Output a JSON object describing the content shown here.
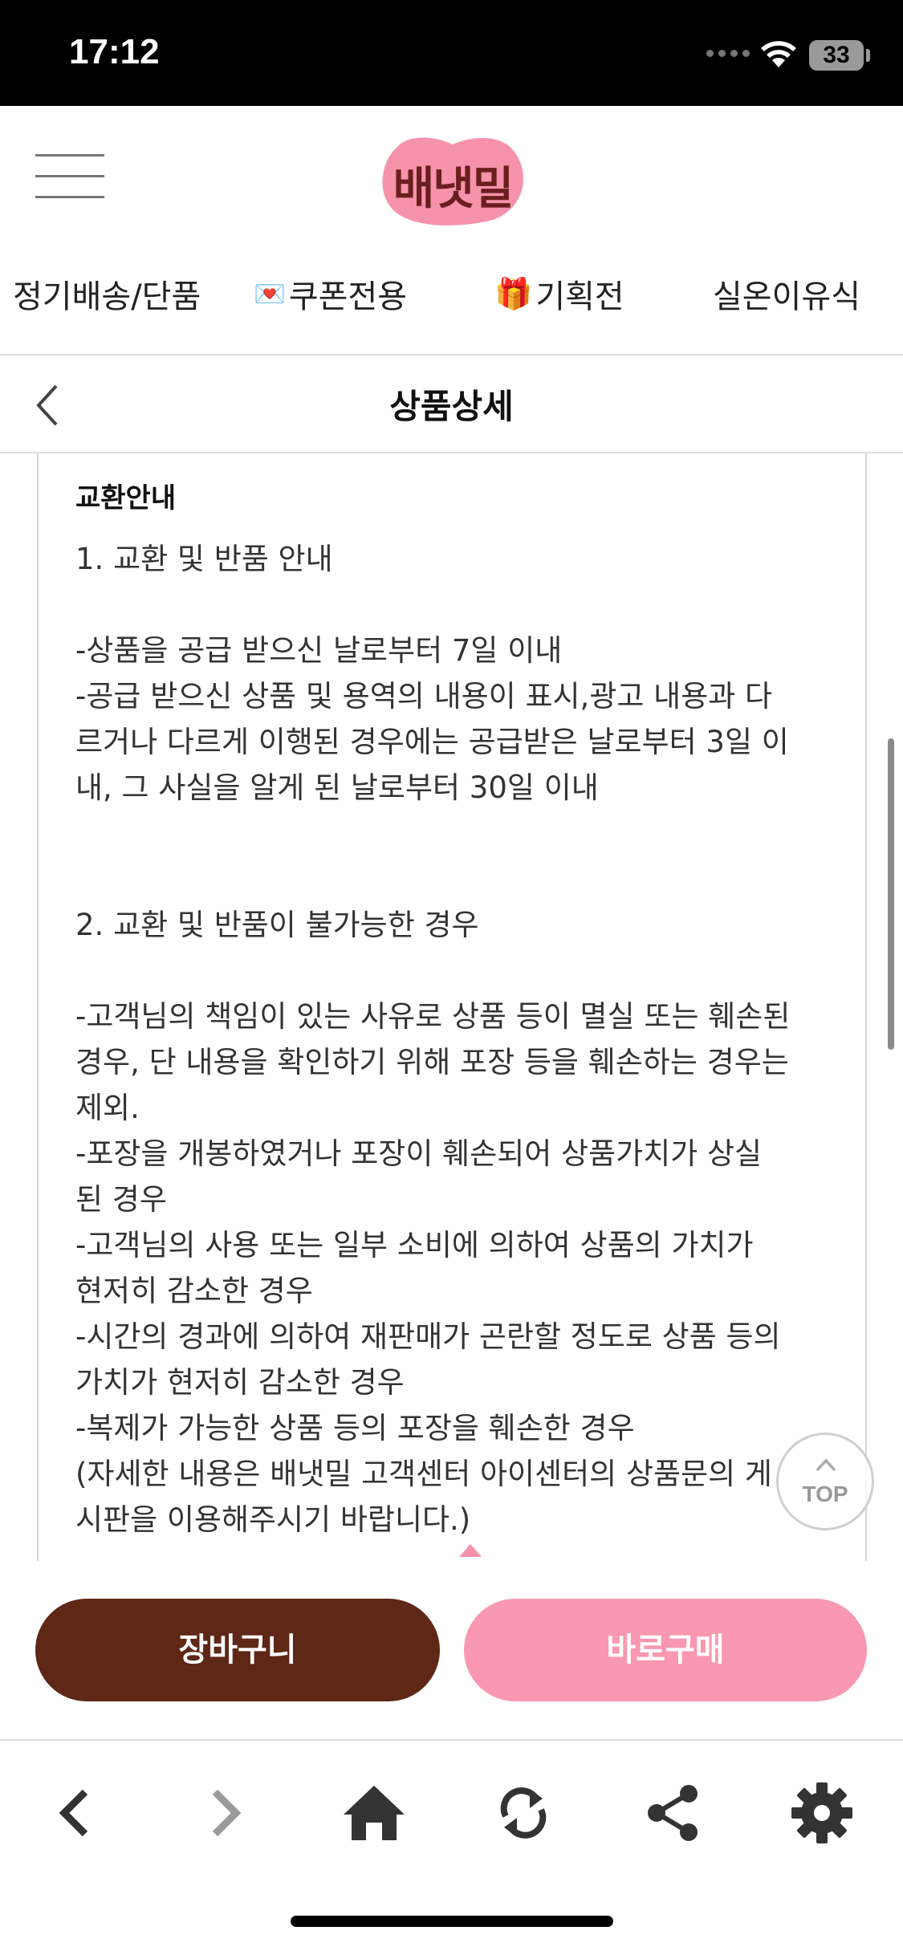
{
  "status_bar": {
    "time": "17:12",
    "battery": "33"
  },
  "header": {
    "logo_text": "배냇밀"
  },
  "categories": [
    {
      "label": "정기배송/단품",
      "emoji": ""
    },
    {
      "label": "쿠폰전용",
      "emoji": "💌"
    },
    {
      "label": "기획전",
      "emoji": "🎁"
    },
    {
      "label": "실온이유식",
      "emoji": ""
    }
  ],
  "title_bar": {
    "title": "상품상세"
  },
  "content": {
    "section_title": "교환안내",
    "lines": [
      "1. 교환 및 반품 안내",
      "",
      "-상품을 공급 받으신 날로부터 7일 이내",
      "-공급 받으신 상품 및 용역의 내용이 표시,광고 내용과 다",
      "르거나 다르게 이행된 경우에는 공급받은 날로부터 3일 이",
      "내, 그 사실을 알게 된 날로부터 30일 이내",
      "",
      "",
      "2. 교환 및 반품이 불가능한 경우",
      "",
      "-고객님의 책임이 있는 사유로 상품 등이 멸실 또는 훼손된",
      "경우, 단 내용을 확인하기 위해 포장 등을 훼손하는 경우는",
      "제외.",
      "-포장을 개봉하였거나 포장이 훼손되어 상품가치가 상실",
      "된 경우",
      "-고객님의 사용  또는 일부 소비에 의하여 상품의 가치가",
      "현저히 감소한 경우",
      "-시간의 경과에 의하여 재판매가 곤란할 정도로 상품 등의",
      "가치가 현저히 감소한 경우",
      "-복제가 가능한 상품 등의 포장을 훼손한 경우",
      "(자세한 내용은 배냇밀 고객센터 아이센터의 상품문의 게",
      "시판을 이용해주시기 바랍니다.)"
    ]
  },
  "top_button": {
    "label": "TOP"
  },
  "buy_bar": {
    "cart_label": "장바구니",
    "buy_label": "바로구매"
  },
  "colors": {
    "cart": "#5e2716",
    "buy": "#f998b0",
    "logo_bg": "#f792ab",
    "logo_text": "#6b1e1e"
  },
  "toolbar": {
    "icons": [
      "back-icon",
      "forward-icon",
      "home-icon",
      "refresh-icon",
      "share-icon",
      "gear-icon"
    ]
  }
}
